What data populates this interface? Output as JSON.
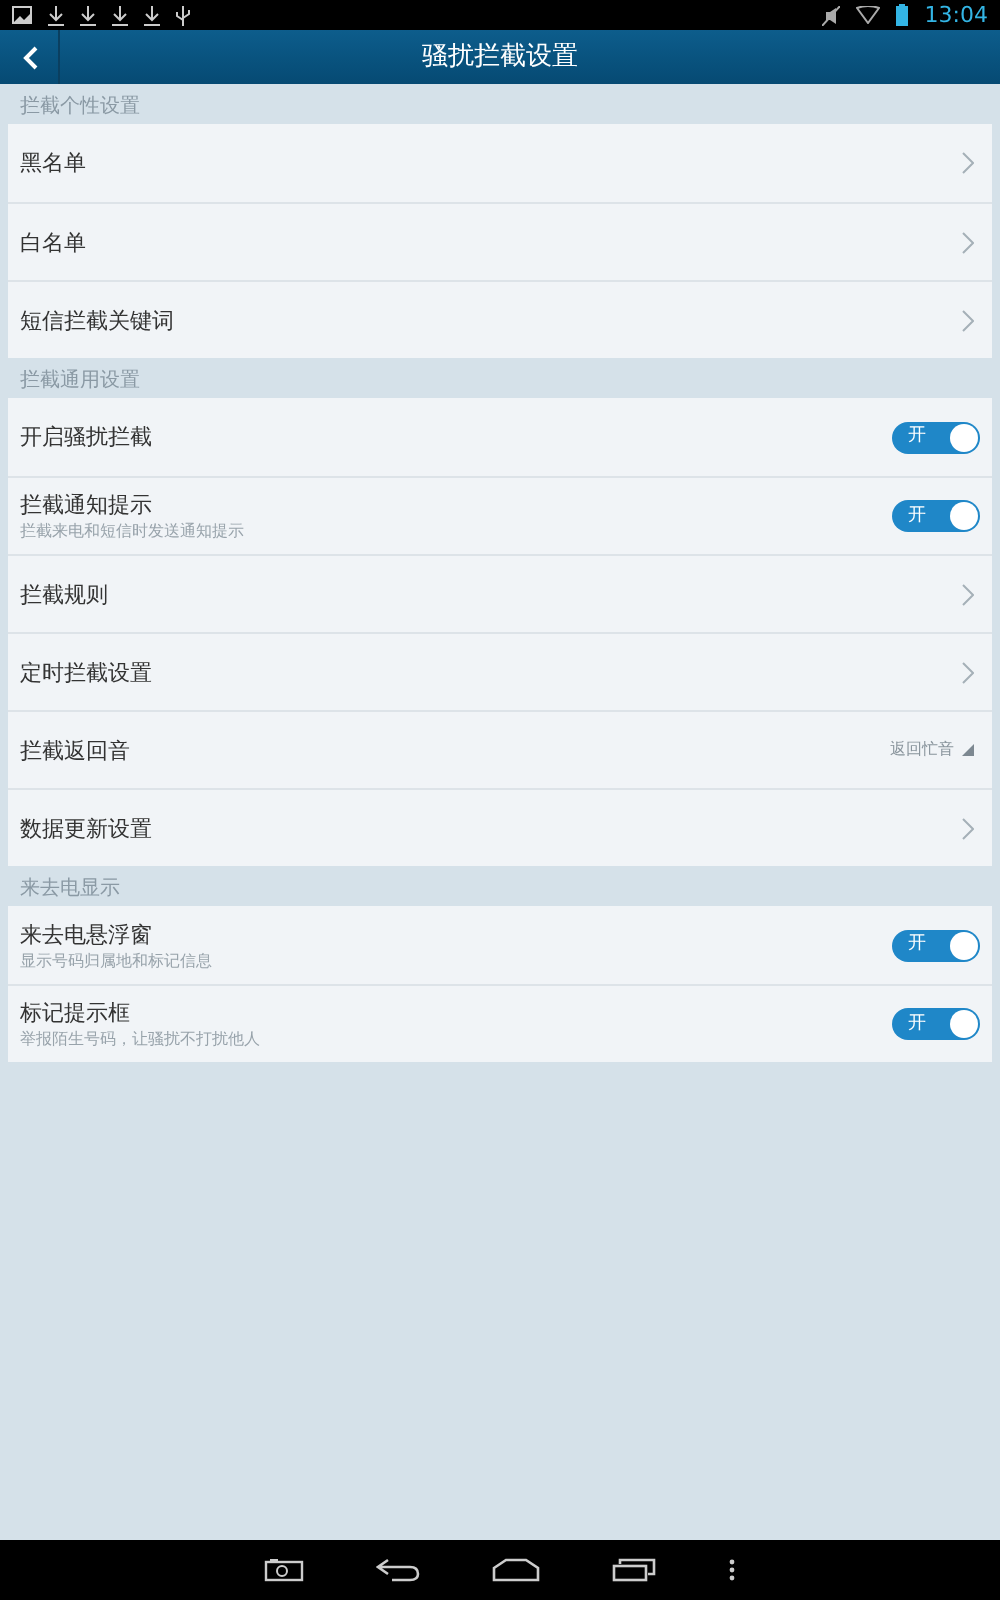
{
  "status_bar": {
    "time": "13:04"
  },
  "header": {
    "title": "骚扰拦截设置"
  },
  "sections": [
    {
      "title": "拦截个性设置",
      "items": [
        {
          "kind": "link",
          "label": "黑名单"
        },
        {
          "kind": "link",
          "label": "白名单"
        },
        {
          "kind": "link",
          "label": "短信拦截关键词"
        }
      ]
    },
    {
      "title": "拦截通用设置",
      "items": [
        {
          "kind": "toggle",
          "label": "开启骚扰拦截",
          "on": true,
          "toggle_text": "开"
        },
        {
          "kind": "toggle",
          "label": "拦截通知提示",
          "subtitle": "拦截来电和短信时发送通知提示",
          "on": true,
          "toggle_text": "开"
        },
        {
          "kind": "link",
          "label": "拦截规则"
        },
        {
          "kind": "link",
          "label": "定时拦截设置"
        },
        {
          "kind": "dropdown",
          "label": "拦截返回音",
          "value": "返回忙音"
        },
        {
          "kind": "link",
          "label": "数据更新设置"
        }
      ]
    },
    {
      "title": "来去电显示",
      "items": [
        {
          "kind": "toggle",
          "label": "来去电悬浮窗",
          "subtitle": "显示号码归属地和标记信息",
          "on": true,
          "toggle_text": "开"
        },
        {
          "kind": "toggle",
          "label": "标记提示框",
          "subtitle": "举报陌生号码，让骚扰不打扰他人",
          "on": true,
          "toggle_text": "开"
        }
      ]
    }
  ]
}
